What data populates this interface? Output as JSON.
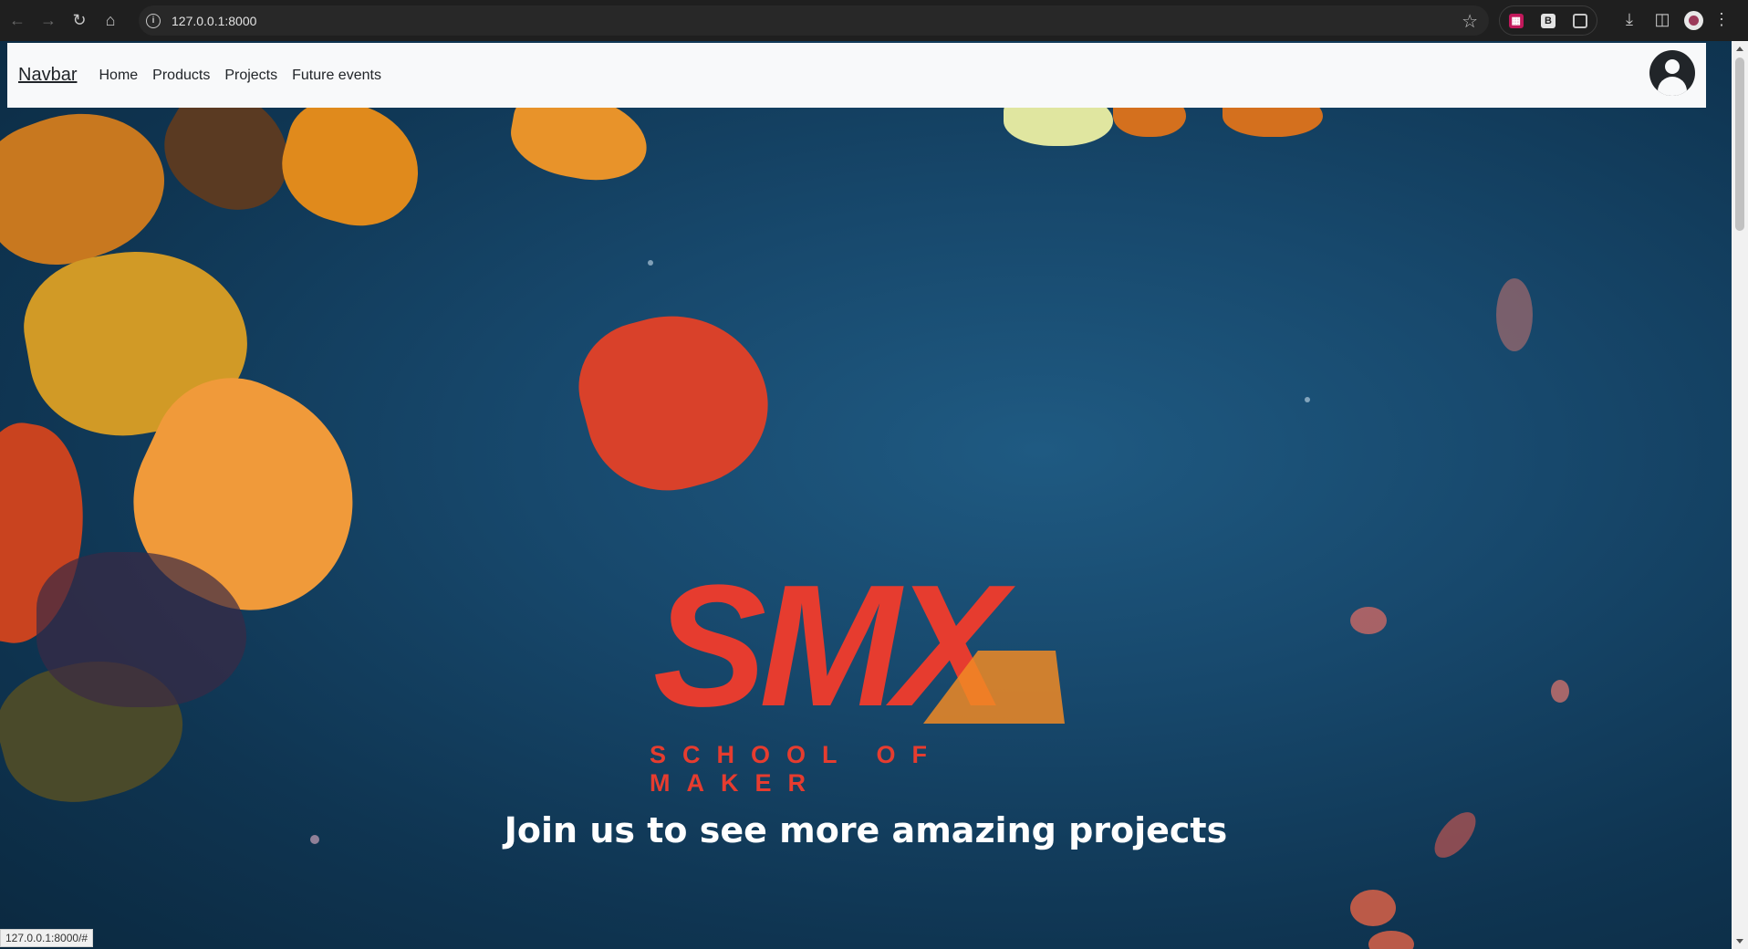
{
  "browser": {
    "url": "127.0.0.1:8000",
    "status_url": "127.0.0.1:8000/#",
    "ext_b_label": "B"
  },
  "navbar": {
    "brand": "Navbar",
    "links": [
      "Home",
      "Products",
      "Projects",
      "Future events"
    ]
  },
  "hero": {
    "logo_text": "SMX",
    "logo_subtitle": "SCHOOL OF MAKER",
    "tagline": "Join us to see more amazing projects"
  },
  "colors": {
    "logo_red": "#e63c2f",
    "logo_orange": "#f08a24",
    "navbar_bg": "#f8f9fa",
    "hero_bg": "#16405f"
  }
}
